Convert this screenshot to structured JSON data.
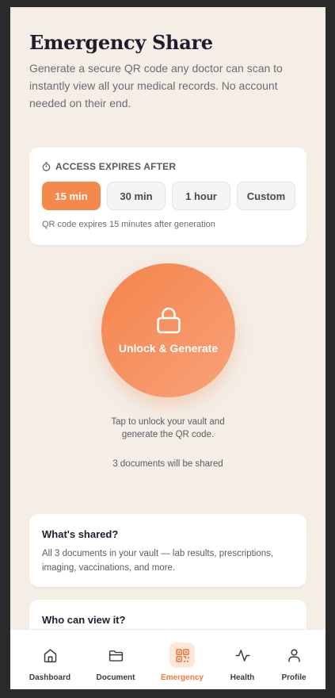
{
  "header": {
    "title": "Emergency Share",
    "subtitle": "Generate a secure QR code any doctor can scan to instantly view all your medical records. No account needed on their end."
  },
  "expiry": {
    "heading": "ACCESS EXPIRES AFTER",
    "heading_icon": "timer-icon",
    "options": [
      "15 min",
      "30 min",
      "1 hour",
      "Custom"
    ],
    "selected": "15 min",
    "note": "QR code expires 15 minutes after generation"
  },
  "unlock": {
    "label": "Unlock & Generate",
    "icon": "lock-icon",
    "hint_line1": "Tap to unlock your vault and",
    "hint_line2": "generate the QR code.",
    "doc_count": "3 documents will be shared"
  },
  "info": {
    "shared_title": "What's shared?",
    "shared_text": "All 3 documents in your vault — lab results, prescriptions, imaging, vaccinations, and more.",
    "who_title": "Who can view it?"
  },
  "nav": {
    "items": [
      {
        "label": "Dashboard",
        "icon": "home-icon"
      },
      {
        "label": "Document",
        "icon": "folder-icon"
      },
      {
        "label": "Emergency",
        "icon": "qr-code-icon"
      },
      {
        "label": "Health",
        "icon": "activity-icon"
      },
      {
        "label": "Profile",
        "icon": "user-icon"
      }
    ],
    "active": "Emergency"
  },
  "colors": {
    "accent": "#f5884b",
    "background": "#f4eee6",
    "title": "#1d1d2e"
  }
}
